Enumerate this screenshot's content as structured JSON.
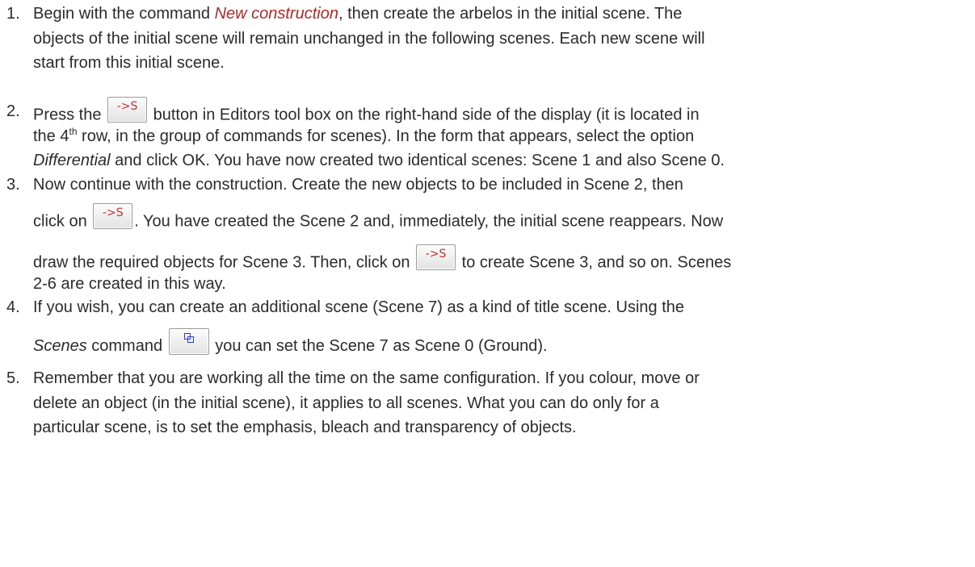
{
  "items": [
    {
      "number": "1.",
      "lines": [
        {
          "pre": "Begin with the command ",
          "em": "New construction",
          "post": ", then create the arbelos in the initial scene. The"
        },
        {
          "text": "objects of the initial scene will remain unchanged in the following scenes. Each new scene will"
        },
        {
          "text": "start from this initial scene."
        }
      ]
    },
    {
      "number": "2.",
      "lines": [
        {
          "pre": "Press the ",
          "post": " button in Editors tool box on the right-hand side of the display (it is located in"
        },
        {
          "pre": "the 4",
          "sup": "th",
          "post": " row, in the group of commands for scenes). In the form that appears, select the option"
        },
        {
          "em": "Differential",
          "post": " and click OK. You have now created two identical scenes: Scene 1 and also Scene 0."
        }
      ]
    },
    {
      "number": "3.",
      "lines": [
        {
          "text": "Now continue with the construction. Create the new objects to be included in Scene 2, then"
        },
        {
          "pre": "click on ",
          "post": ". You have created the Scene 2 and, immediately, the initial scene reappears. Now"
        },
        {
          "pre": "draw the required objects for Scene 3. Then, click on ",
          "post": " to create Scene 3, and so on. Scenes"
        },
        {
          "text": "2-6 are created in this way."
        }
      ]
    },
    {
      "number": "4.",
      "lines": [
        {
          "text": "If you wish, you can create an additional scene (Scene 7) as a kind of title scene. Using the"
        },
        {
          "em": "Scenes",
          "mid": " command ",
          "post": " you can set the Scene 7 as Scene 0 (Ground)."
        }
      ]
    },
    {
      "number": "5.",
      "lines": [
        {
          "text": "Remember that you are working all the time on the same configuration. If you colour, move or"
        },
        {
          "text": "delete an object (in the initial scene), it applies to all scenes. What you can do only for a"
        },
        {
          "text": "particular scene, is to set the emphasis, bleach and transparency of objects."
        }
      ]
    }
  ],
  "buttons": {
    "scene_label": "->S",
    "scenes_icon": "overlapping-squares-icon"
  },
  "colors": {
    "text": "#2b2b2b",
    "button_label": "#c03030",
    "scenes_icon": "#2a3fd0"
  }
}
